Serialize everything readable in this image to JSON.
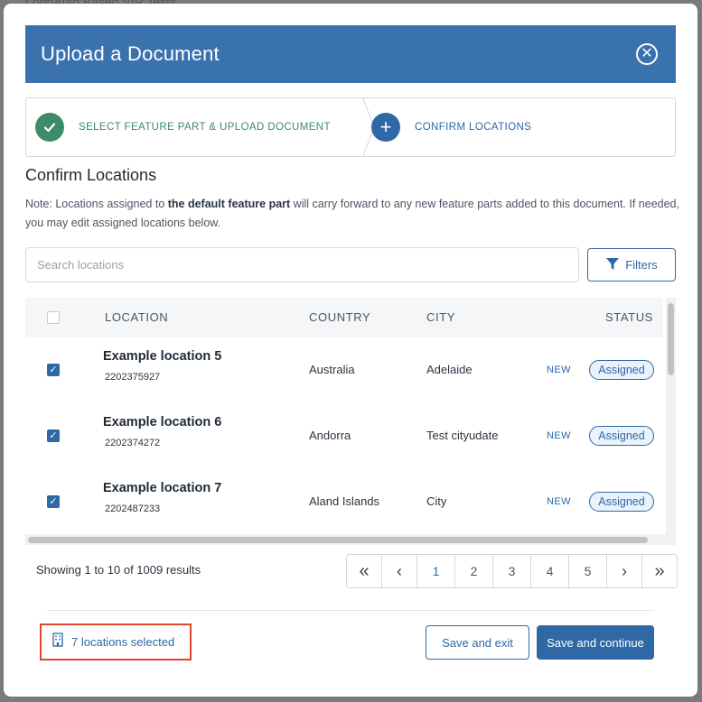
{
  "backdrop": {
    "text": "LoopAuto Based VIR Tests"
  },
  "header": {
    "title": "Upload a Document",
    "close_icon": "close-circle-icon"
  },
  "stepper": {
    "steps": [
      {
        "label": "SELECT FEATURE PART & UPLOAD DOCUMENT",
        "state": "done",
        "icon": "checkmark-icon"
      },
      {
        "label": "CONFIRM LOCATIONS",
        "state": "active",
        "icon": "plus-icon"
      }
    ]
  },
  "section": {
    "title": "Confirm Locations",
    "note_prefix": "Note: Locations assigned to ",
    "note_bold": "the default feature part",
    "note_suffix": " will carry forward to any new feature parts added to this document. If needed, you may edit assigned locations below."
  },
  "search": {
    "placeholder": "Search locations",
    "value": ""
  },
  "filters": {
    "label": "Filters",
    "icon": "funnel-icon"
  },
  "table": {
    "columns": [
      "LOCATION",
      "COUNTRY",
      "CITY",
      "STATUS"
    ],
    "rows": [
      {
        "name": "Example location 5",
        "code": "2202375927",
        "country": "Australia",
        "city": "Adelaide",
        "tag": "NEW",
        "status": "Assigned",
        "checked": true
      },
      {
        "name": "Example location 6",
        "code": "2202374272",
        "country": "Andorra",
        "city": "Test cityudate",
        "tag": "NEW",
        "status": "Assigned",
        "checked": true
      },
      {
        "name": "Example location 7",
        "code": "2202487233",
        "country": "Aland Islands",
        "city": "City",
        "tag": "NEW",
        "status": "Assigned",
        "checked": true
      }
    ]
  },
  "pagination": {
    "summary": "Showing 1 to 10 of 1009 results",
    "first": "«",
    "prev": "‹",
    "pages": [
      "1",
      "2",
      "3",
      "4",
      "5"
    ],
    "current": "1",
    "next": "›",
    "last": "»"
  },
  "footer": {
    "selected_label": "7 locations selected",
    "selected_icon": "building-icon",
    "save_exit": "Save and exit",
    "save_continue": "Save and continue"
  },
  "colors": {
    "header": "#3a72ad",
    "primary": "#2e68a5",
    "success": "#3d8b6b",
    "highlight": "#e0452e"
  }
}
